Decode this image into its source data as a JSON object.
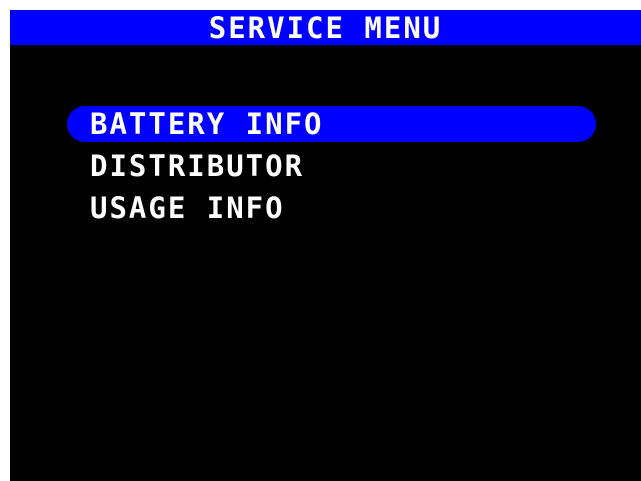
{
  "header": {
    "title": "SERVICE MENU"
  },
  "menu": {
    "items": [
      {
        "label": "BATTERY INFO",
        "selected": true
      },
      {
        "label": "DISTRIBUTOR",
        "selected": false
      },
      {
        "label": "USAGE INFO",
        "selected": false
      }
    ]
  },
  "colors": {
    "title_bar": "#0000ff",
    "screen_background": "#000000",
    "text": "#ffffff",
    "selection_highlight": "#0000ff"
  }
}
